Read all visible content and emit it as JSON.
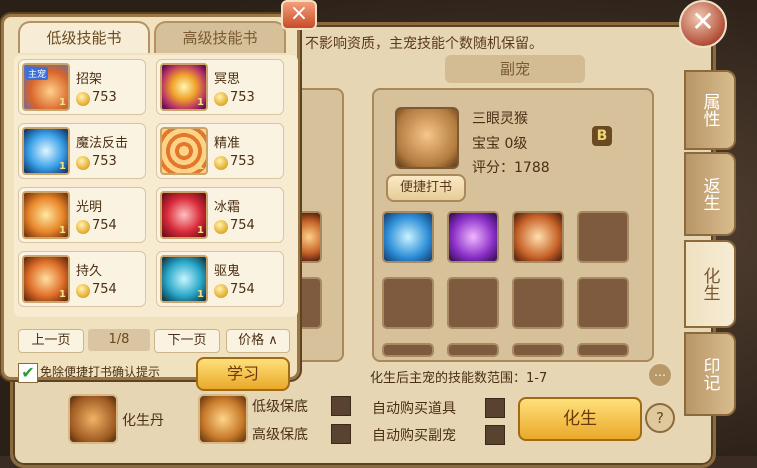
{
  "notice_text": "不影响资质，主宠技能个数随机保留。",
  "sub_pet_title": "副宠",
  "pet": {
    "name": "三眼灵猴",
    "level": "宝宝 0级",
    "score": "评分：1788",
    "badge": "B"
  },
  "quick_book_label": "便捷打书",
  "range_text": "化生后主宠的技能数范围：1-7",
  "side_tabs": [
    {
      "label": "属性"
    },
    {
      "label": "返生"
    },
    {
      "label": "化生"
    },
    {
      "label": "印记"
    }
  ],
  "bottom": {
    "pill_label": "化生丹",
    "low_guard": "低级保底",
    "high_guard": "高级保底",
    "auto_buy_item": "自动购买道具",
    "auto_buy_pet": "自动购买副宠",
    "rebirth_button": "化生",
    "help": "?"
  },
  "popup": {
    "tabs": [
      "低级技能书",
      "高级技能书"
    ],
    "close": "×",
    "skills": [
      {
        "name": "招架",
        "price": "753",
        "level": "1",
        "tag": "主宠"
      },
      {
        "name": "冥思",
        "price": "753",
        "level": "1"
      },
      {
        "name": "魔法反击",
        "price": "753",
        "level": "1"
      },
      {
        "name": "精准",
        "price": "753",
        "level": "1"
      },
      {
        "name": "光明",
        "price": "754",
        "level": "1"
      },
      {
        "name": "冰霜",
        "price": "754",
        "level": "1"
      },
      {
        "name": "持久",
        "price": "754",
        "level": "1"
      },
      {
        "name": "驱鬼",
        "price": "754",
        "level": "1"
      }
    ],
    "prev_page": "上一页",
    "page": "1/8",
    "next_page": "下一页",
    "sort": "价格 ∧",
    "confirm_label": "免除便捷打书确认提示",
    "learn_button": "学习"
  },
  "colors": {
    "accent_gold": "#e9a92a",
    "panel": "#f1e2bf",
    "border": "#9a7546"
  }
}
